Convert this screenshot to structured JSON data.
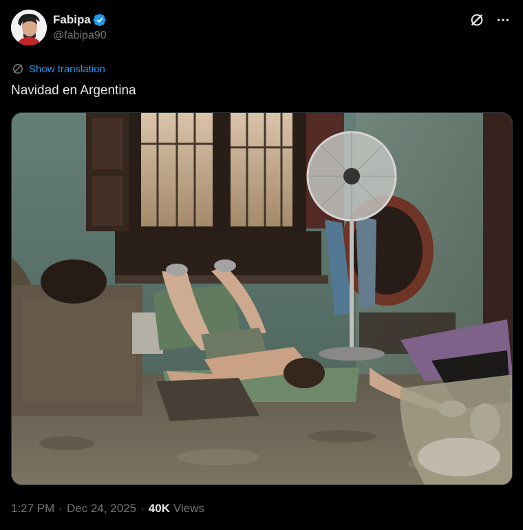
{
  "author": {
    "display_name": "Fabipa",
    "handle": "@fabipa90",
    "verified": true,
    "avatar_icon": "profile-avatar"
  },
  "actions": {
    "grok_icon": "grok-icon",
    "more_icon": "more-horizontal-icon"
  },
  "translation": {
    "label": "Show translation",
    "icon": "translate-icon"
  },
  "tweet": {
    "text": "Navidad en Argentina"
  },
  "media": {
    "alt": "",
    "icon": "photo"
  },
  "meta": {
    "time": "1:27 PM",
    "separator": "·",
    "date": "Dec 24, 2025",
    "views_count": "40K",
    "views_label": "Views"
  },
  "colors": {
    "background": "#000000",
    "text_primary": "#e7e9ea",
    "text_secondary": "#71767b",
    "link": "#1d9bf0",
    "verified": "#1d9bf0"
  }
}
